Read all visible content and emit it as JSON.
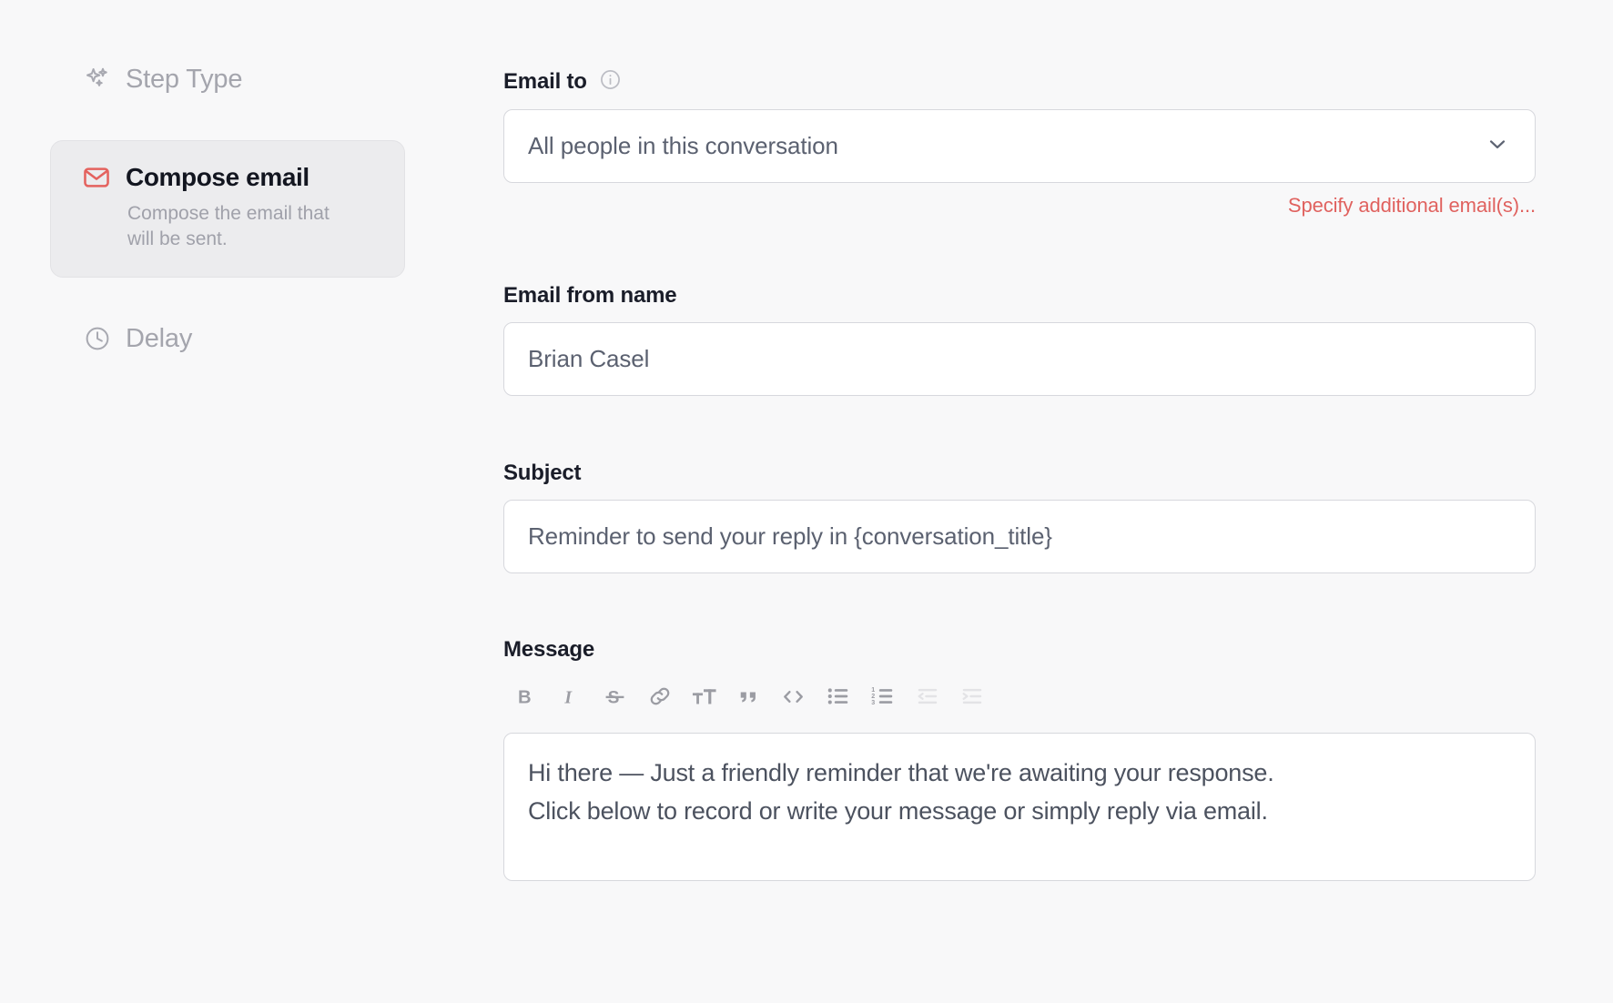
{
  "sidebar": {
    "step_type": {
      "label": "Step Type",
      "icon": "sparkles-icon"
    },
    "selected_step": {
      "title": "Compose email",
      "description": "Compose the email that will be sent.",
      "icon": "envelope-icon"
    },
    "delay": {
      "label": "Delay",
      "icon": "clock-icon"
    }
  },
  "form": {
    "email_to": {
      "label": "Email to",
      "info_icon": "info-circle-icon",
      "selected_value": "All people in this conversation",
      "chevron_icon": "chevron-down-icon",
      "helper_link": "Specify additional email(s)..."
    },
    "email_from_name": {
      "label": "Email from name",
      "value": "Brian Casel",
      "placeholder": "Email from name"
    },
    "subject": {
      "label": "Subject",
      "value": "Reminder to send your reply in {conversation_title}",
      "placeholder": "Subject"
    },
    "message": {
      "label": "Message",
      "toolbar": [
        {
          "name": "bold-icon",
          "title": "Bold",
          "enabled": true
        },
        {
          "name": "italic-icon",
          "title": "Italic",
          "enabled": true
        },
        {
          "name": "strikethrough-icon",
          "title": "Strikethrough",
          "enabled": true
        },
        {
          "name": "link-icon",
          "title": "Link",
          "enabled": true
        },
        {
          "name": "text-size-icon",
          "title": "Text size",
          "enabled": true
        },
        {
          "name": "blockquote-icon",
          "title": "Quote",
          "enabled": true
        },
        {
          "name": "code-icon",
          "title": "Code",
          "enabled": true
        },
        {
          "name": "bulleted-list-icon",
          "title": "Bulleted list",
          "enabled": true
        },
        {
          "name": "numbered-list-icon",
          "title": "Numbered list",
          "enabled": true
        },
        {
          "name": "outdent-icon",
          "title": "Outdent",
          "enabled": false
        },
        {
          "name": "indent-icon",
          "title": "Indent",
          "enabled": false
        }
      ],
      "body_line_1": "Hi there — Just a friendly reminder that we're awaiting your response.",
      "body_line_2": "Click below to record or write your message or simply reply via email."
    }
  },
  "colors": {
    "accent_red": "#E0625F",
    "page_background": "#F8F8F9",
    "card_background": "#ECECEE",
    "muted_text": "#A4A5AD",
    "body_text": "#4C525F",
    "heading_text": "#1A1D29",
    "border": "#D7D8DD"
  }
}
